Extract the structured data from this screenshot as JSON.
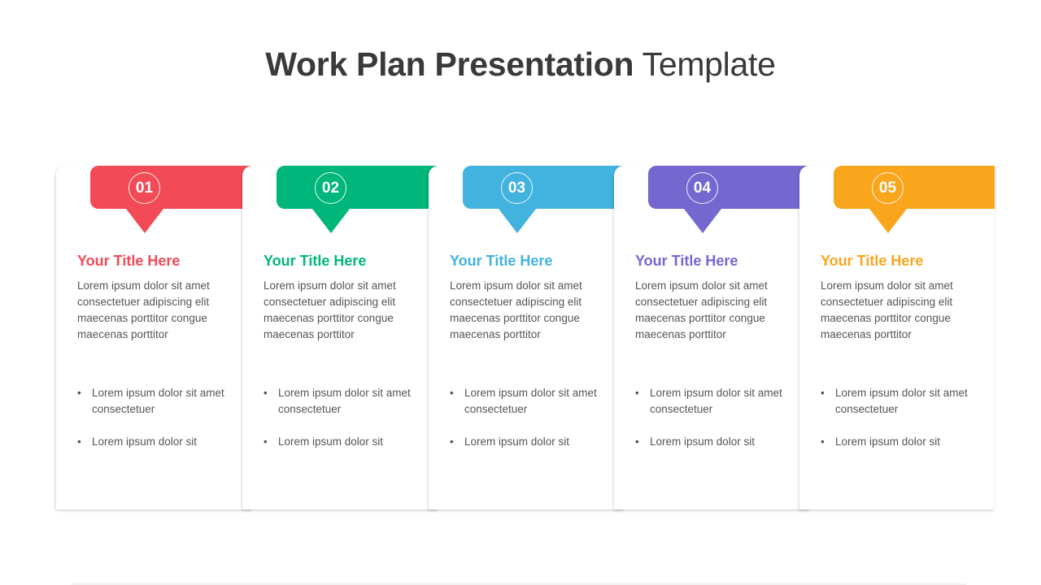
{
  "title": {
    "bold": "Work Plan Presentation",
    "light": "Template"
  },
  "steps": [
    {
      "number": "01",
      "color": "#f24a56",
      "title": "Your Title Here",
      "body": "Lorem ipsum dolor sit amet consectetuer adipiscing elit maecenas porttitor congue maecenas porttitor",
      "bullets": [
        "Lorem ipsum dolor sit amet consectetuer",
        "Lorem ipsum dolor sit"
      ]
    },
    {
      "number": "02",
      "color": "#00b67a",
      "title": "Your Title Here",
      "body": "Lorem ipsum dolor sit amet consectetuer adipiscing elit maecenas porttitor congue maecenas porttitor",
      "bullets": [
        "Lorem ipsum dolor sit amet consectetuer",
        "Lorem ipsum dolor sit"
      ]
    },
    {
      "number": "03",
      "color": "#42b2de",
      "title": "Your Title Here",
      "body": "Lorem ipsum dolor sit amet consectetuer adipiscing elit maecenas porttitor congue maecenas porttitor",
      "bullets": [
        "Lorem ipsum dolor sit amet consectetuer",
        "Lorem ipsum dolor sit"
      ]
    },
    {
      "number": "04",
      "color": "#7467cf",
      "title": "Your Title Here",
      "body": "Lorem ipsum dolor sit amet consectetuer adipiscing elit maecenas porttitor congue maecenas porttitor",
      "bullets": [
        "Lorem ipsum dolor sit amet consectetuer",
        "Lorem ipsum dolor sit"
      ]
    },
    {
      "number": "05",
      "color": "#f9a61c",
      "title": "Your Title Here",
      "body": "Lorem ipsum dolor sit amet consectetuer adipiscing elit maecenas porttitor congue maecenas porttitor",
      "bullets": [
        "Lorem ipsum dolor sit amet consectetuer",
        "Lorem ipsum dolor sit"
      ]
    }
  ],
  "bullet_glyph": "•"
}
